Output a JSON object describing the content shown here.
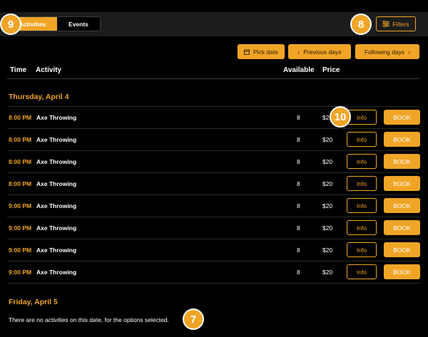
{
  "tabs": {
    "activities": "Activities",
    "events": "Events"
  },
  "filters_label": "Filters",
  "markers": {
    "m9": "9",
    "m8": "8",
    "m10": "10",
    "m7": "7"
  },
  "nav": {
    "pick_date": "Pick date",
    "previous_days": "Previous days",
    "following_days": "Following days"
  },
  "columns": {
    "time": "Time",
    "activity": "Activity",
    "available": "Available",
    "price": "Price"
  },
  "days": [
    {
      "heading": "Thursday, April 4",
      "rows": [
        {
          "time": "8:00 PM",
          "activity": "Axe Throwing",
          "available": "8",
          "price": "$20",
          "info": "Info",
          "book": "BOOK"
        },
        {
          "time": "8:00 PM",
          "activity": "Axe Throwing",
          "available": "8",
          "price": "$20",
          "info": "Info",
          "book": "BOOK"
        },
        {
          "time": "8:00 PM",
          "activity": "Axe Throwing",
          "available": "8",
          "price": "$20",
          "info": "Info",
          "book": "BOOK"
        },
        {
          "time": "8:00 PM",
          "activity": "Axe Throwing",
          "available": "8",
          "price": "$20",
          "info": "Info",
          "book": "BOOK"
        },
        {
          "time": "9:00 PM",
          "activity": "Axe Throwing",
          "available": "8",
          "price": "$20",
          "info": "Info",
          "book": "BOOK"
        },
        {
          "time": "9:00 PM",
          "activity": "Axe Throwing",
          "available": "8",
          "price": "$20",
          "info": "Info",
          "book": "BOOK"
        },
        {
          "time": "9:00 PM",
          "activity": "Axe Throwing",
          "available": "8",
          "price": "$20",
          "info": "Info",
          "book": "BOOK"
        },
        {
          "time": "9:00 PM",
          "activity": "Axe Throwing",
          "available": "8",
          "price": "$20",
          "info": "Info",
          "book": "BOOK"
        }
      ]
    },
    {
      "heading": "Friday, April 5",
      "empty_message": "There are no activities on this date, for the options selected."
    }
  ],
  "colors": {
    "accent": "#f0a526",
    "background": "#000000",
    "bar": "#1c1c1c"
  }
}
